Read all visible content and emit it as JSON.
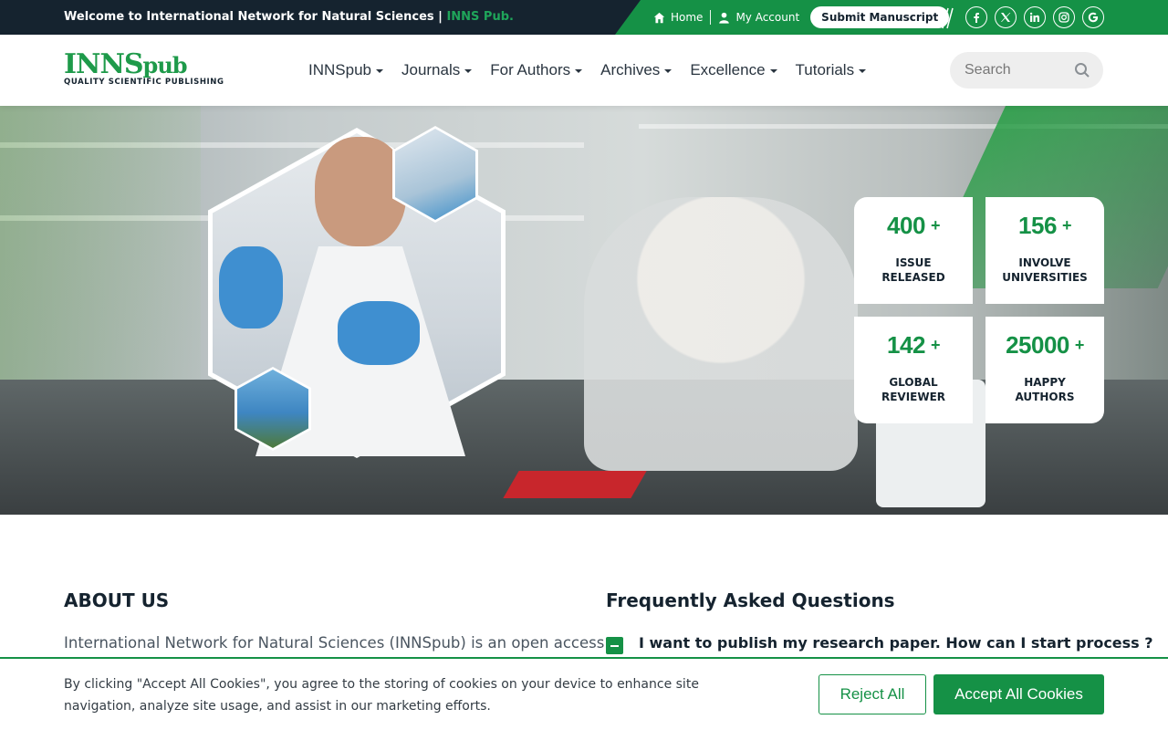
{
  "topbar": {
    "welcome": "Welcome to International Network for Natural Sciences |",
    "brand": "INNS Pub.",
    "links": {
      "home": "Home",
      "account": "My Account"
    },
    "submit": "Submit Manuscript",
    "socials": [
      "facebook-icon",
      "x-icon",
      "linkedin-icon",
      "instagram-icon",
      "google-icon"
    ]
  },
  "header": {
    "logo_main": "INNS",
    "logo_sub": "pub",
    "logo_tagline": "QUALITY SCIENTIFIC PUBLISHING",
    "nav": [
      "INNSpub",
      "Journals",
      "For Authors",
      "Archives",
      "Excellence",
      "Tutorials"
    ],
    "search_placeholder": "Search"
  },
  "stats": [
    {
      "number": "400",
      "plus": "+",
      "line1": "ISSUE",
      "line2": "RELEASED"
    },
    {
      "number": "156",
      "plus": "+",
      "line1": "INVOLVE",
      "line2": "UNIVERSITIES"
    },
    {
      "number": "142",
      "plus": "+",
      "line1": "GLOBAL",
      "line2": "REVIEWER"
    },
    {
      "number": "25000",
      "plus": "+",
      "line1": "HAPPY",
      "line2": "AUTHORS"
    }
  ],
  "about": {
    "title": "ABOUT US",
    "text": "International Network for Natural Sciences (INNSpub) is an open access"
  },
  "faq": {
    "title": "Frequently Asked Questions",
    "q1": "I want to publish my research paper. How can I start process ?"
  },
  "cookie": {
    "text": "By clicking \"Accept All Cookies\", you agree to the storing of cookies on your device to enhance site navigation, analyze site usage, and assist in our marketing efforts.",
    "reject": "Reject All",
    "accept": "Accept All Cookies"
  },
  "colors": {
    "dark": "#15232f",
    "green": "#159146"
  }
}
